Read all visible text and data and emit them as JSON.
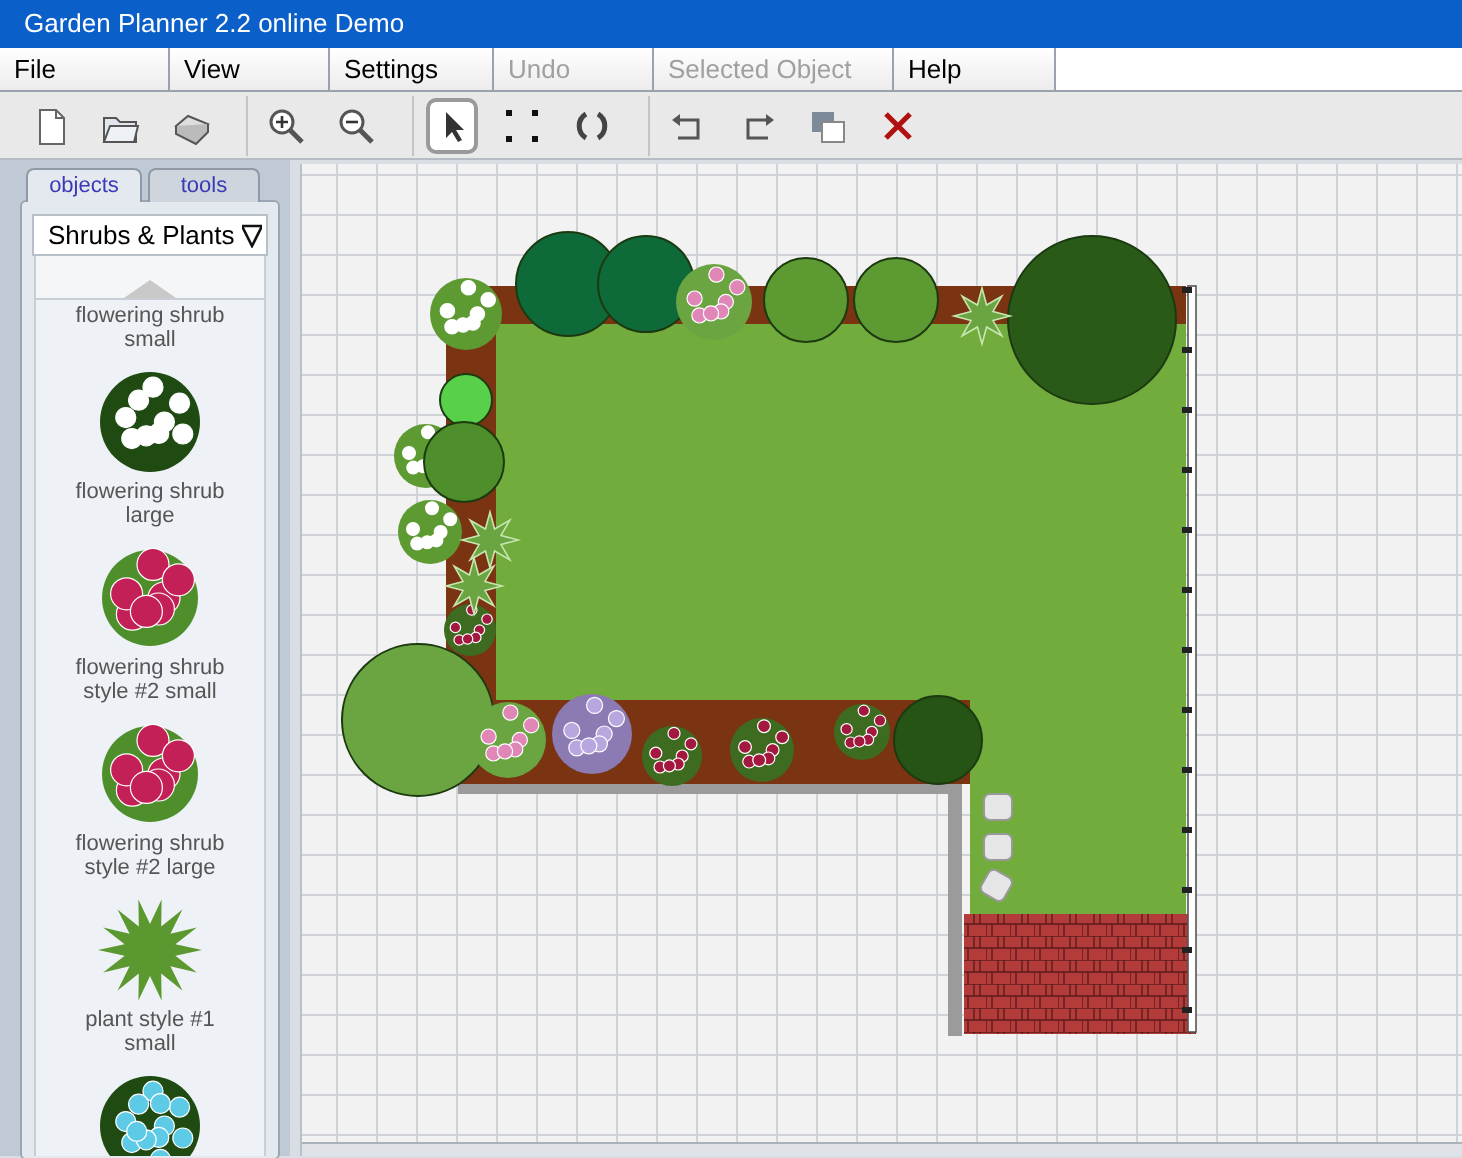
{
  "window": {
    "title": "Garden Planner 2.2 online Demo"
  },
  "menu": [
    {
      "label": "File",
      "disabled": false
    },
    {
      "label": "View",
      "disabled": false
    },
    {
      "label": "Settings",
      "disabled": false
    },
    {
      "label": "Undo",
      "disabled": true
    },
    {
      "label": "Selected Object",
      "disabled": true
    },
    {
      "label": "Help",
      "disabled": false
    }
  ],
  "toolbar": [
    {
      "buttons": [
        {
          "kind": "new",
          "selected": false
        },
        {
          "kind": "open",
          "selected": false
        },
        {
          "kind": "print",
          "selected": false
        }
      ]
    },
    {
      "buttons": [
        {
          "kind": "zoom-in",
          "selected": false
        },
        {
          "kind": "zoom-out",
          "selected": false
        }
      ]
    },
    {
      "buttons": [
        {
          "kind": "pointer",
          "selected": true
        },
        {
          "kind": "marquee",
          "selected": false
        },
        {
          "kind": "rotate",
          "selected": false
        }
      ]
    },
    {
      "buttons": [
        {
          "kind": "rotate-left",
          "selected": false
        },
        {
          "kind": "rotate-right",
          "selected": false
        },
        {
          "kind": "layer",
          "selected": false
        },
        {
          "kind": "delete",
          "selected": false
        }
      ]
    }
  ],
  "panel": {
    "tabs": [
      {
        "label": "objects",
        "selected": true
      },
      {
        "label": "tools",
        "selected": false
      }
    ],
    "category": "Shrubs & Plants",
    "items": [
      {
        "kind": "none",
        "label": "flowering shrub\nsmall"
      },
      {
        "kind": "white-flowers",
        "label": "flowering shrub\nlarge"
      },
      {
        "kind": "roses",
        "label": "flowering shrub\nstyle #2 small"
      },
      {
        "kind": "roses",
        "label": "flowering shrub\nstyle #2 large"
      },
      {
        "kind": "spiky",
        "label": "plant style #1\nsmall"
      },
      {
        "kind": "blue-flowers"
      }
    ]
  }
}
